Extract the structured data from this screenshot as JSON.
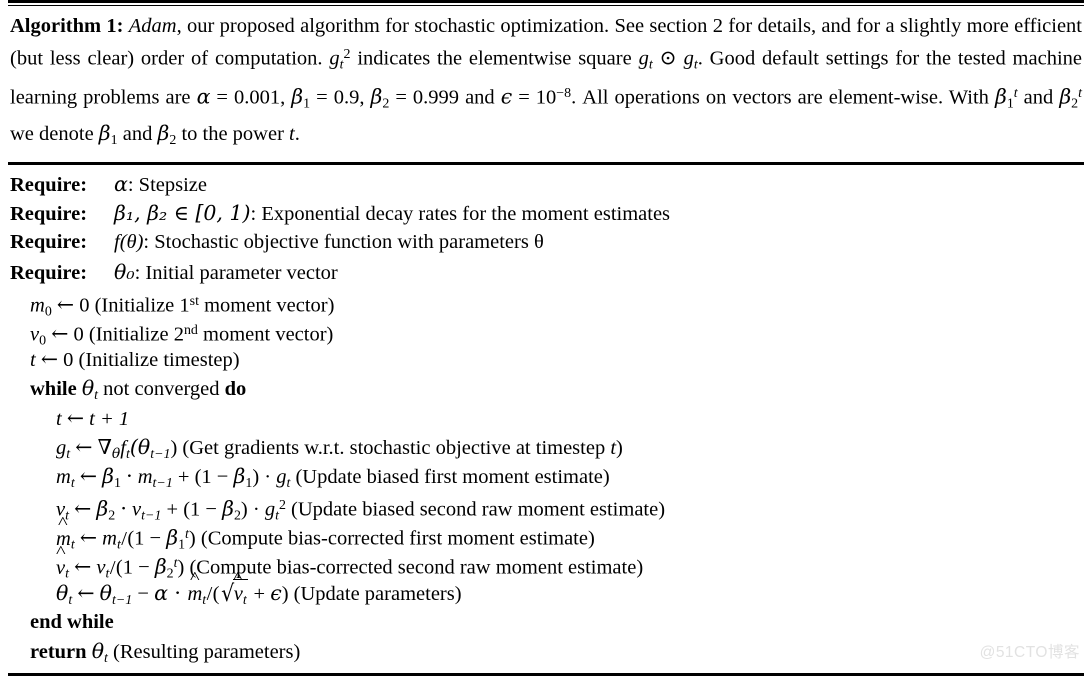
{
  "figure": {
    "kind": "algorithm-pseudocode",
    "background_color": "#ffffff",
    "text_color": "#000000"
  },
  "caption": {
    "label": "Algorithm 1:",
    "name": "Adam",
    "text_part1": ", our proposed algorithm for stochastic optimization. See section 2 for details, and for a slightly more efficient (but less clear) order of computation. ",
    "g_squared": "g",
    "g_squared_sub": "t",
    "g_squared_sup": "2",
    "text_part2": " indicates the elementwise square ",
    "square_expr": "g",
    "square_sub1": "t",
    "odot": "⊙",
    "square_sub2": "t",
    "text_part3": ". Good default settings for the tested machine learning problems are ",
    "alpha": "α",
    "alpha_eq": " = 0.001, ",
    "beta1": "β",
    "beta1_sub": "1",
    "beta1_eq": " = 0.9, ",
    "beta2": "β",
    "beta2_sub": "2",
    "beta2_eq": " = 0.999 and ",
    "epsilon": "ϵ",
    "epsilon_eq": " = 10",
    "epsilon_exp": "−8",
    "text_part4": ". All operations on vectors are element-wise. With ",
    "betat1": "β",
    "betat1_sub": "1",
    "betat1_sup": "t",
    "and_text": " and ",
    "betat2": "β",
    "betat2_sub": "2",
    "betat2_sup": "t",
    "text_part5": " we denote ",
    "b1": "β",
    "b1_sub": "1",
    "and_text2": " and ",
    "b2": "β",
    "b2_sub": "2",
    "text_part6": " to the power ",
    "t_var": "t",
    "period": "."
  },
  "requires": [
    {
      "label": "Require:",
      "symbol": "α",
      "description": ": Stepsize"
    },
    {
      "label": "Require:",
      "symbol": "β₁, β₂ ∈ [0, 1)",
      "description": ": Exponential decay rates for the moment estimates"
    },
    {
      "label": "Require:",
      "symbol": "f(θ)",
      "description": ": Stochastic objective function with parameters θ"
    },
    {
      "label": "Require:",
      "symbol": "θ₀",
      "description": ": Initial parameter vector"
    }
  ],
  "steps": {
    "init_m": {
      "var": "m",
      "sub": "0",
      "arrow": "←",
      "value": "0",
      "comment": "(Initialize 1",
      "ordinal": "st",
      "comment_end": " moment vector)"
    },
    "init_v": {
      "var": "v",
      "sub": "0",
      "arrow": "←",
      "value": "0",
      "comment": "(Initialize 2",
      "ordinal": "nd",
      "comment_end": " moment vector)"
    },
    "init_t": {
      "var": "t",
      "arrow": "←",
      "value": "0",
      "comment": "(Initialize timestep)"
    },
    "while": {
      "kw_while": "while",
      "var": "θ",
      "sub": "t",
      "mid": " not converged ",
      "kw_do": "do"
    },
    "incr_t": {
      "var": "t",
      "arrow": "←",
      "expr": "t + 1"
    },
    "grad": {
      "var": "g",
      "sub": "t",
      "arrow": "←",
      "nabla": "∇",
      "nabla_sub": "θ",
      "f": "f",
      "f_sub": "t",
      "arg": "(θ",
      "arg_sub": "t−1",
      "arg_close": ")",
      "comment": " (Get gradients w.r.t. stochastic objective at timestep ",
      "comment_var": "t",
      "comment_close": ")"
    },
    "m_update": {
      "var": "m",
      "sub": "t",
      "arrow": "←",
      "beta": "β",
      "beta_sub": "1",
      "dot": "·",
      "prev": "m",
      "prev_sub": "t−1",
      "plus": " + (1 − ",
      "beta2": "β",
      "beta2_sub": "1",
      "close": ") · ",
      "g": "g",
      "g_sub": "t",
      "comment": " (Update biased first moment estimate)"
    },
    "v_update": {
      "var": "v",
      "sub": "t",
      "arrow": "←",
      "beta": "β",
      "beta_sub": "2",
      "dot": "·",
      "prev": "v",
      "prev_sub": "t−1",
      "plus": " + (1 − ",
      "beta2": "β",
      "beta2_sub": "2",
      "close": ") · ",
      "g": "g",
      "g_sub": "t",
      "g_sup": "2",
      "comment": " (Update biased second raw moment estimate)"
    },
    "mhat": {
      "var": "m",
      "sub": "t",
      "arrow": "←",
      "num": "m",
      "num_sub": "t",
      "slash": "/",
      "denom_open": "(1 − ",
      "beta": "β",
      "beta_sub": "1",
      "beta_sup": "t",
      "denom_close": ")",
      "comment": " (Compute bias-corrected first moment estimate)"
    },
    "vhat": {
      "var": "v",
      "sub": "t",
      "arrow": "←",
      "num": "v",
      "num_sub": "t",
      "slash": "/",
      "denom_open": "(1 − ",
      "beta": "β",
      "beta_sub": "2",
      "beta_sup": "t",
      "denom_close": ")",
      "comment": " (Compute bias-corrected second raw moment estimate)"
    },
    "theta_update": {
      "var": "θ",
      "sub": "t",
      "arrow": "←",
      "prev": "θ",
      "prev_sub": "t−1",
      "minus": " − ",
      "alpha": "α",
      "dot": " · ",
      "mhat": "m",
      "mhat_sub": "t",
      "slash": "/",
      "open": "(",
      "radical": "√",
      "vhat": "v",
      "vhat_sub": "t",
      "plus": " + ",
      "epsilon": "ϵ",
      "close": ")",
      "comment": " (Update parameters)"
    },
    "end_while": {
      "label": "end while"
    },
    "return": {
      "kw": "return",
      "var": "θ",
      "sub": "t",
      "comment": " (Resulting parameters)"
    }
  },
  "watermark": {
    "text": "@51CTO博客",
    "color": "#e2e2e2"
  }
}
